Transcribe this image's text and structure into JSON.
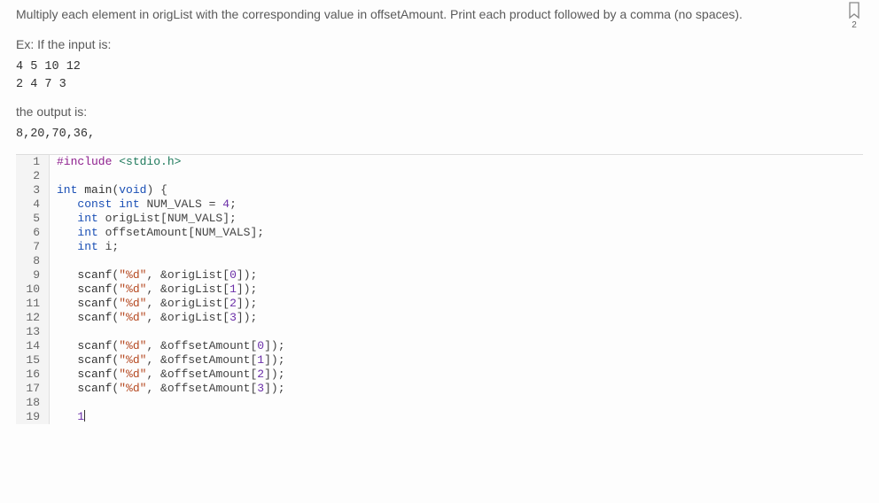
{
  "problem": {
    "description": "Multiply each element in origList with the corresponding value in offsetAmount. Print each product followed by a comma (no spaces).",
    "example_label": "Ex: If the input is:",
    "example_input": "4 5 10 12\n2 4 7 3",
    "output_label": "the output is:",
    "example_output": "8,20,70,36,"
  },
  "bookmark": {
    "count": "2"
  },
  "code": {
    "lines": [
      {
        "n": "1",
        "tokens": [
          [
            "pp",
            "#include "
          ],
          [
            "inc",
            "<stdio.h>"
          ]
        ]
      },
      {
        "n": "2",
        "tokens": []
      },
      {
        "n": "3",
        "tokens": [
          [
            "type",
            "int"
          ],
          [
            "plain",
            " "
          ],
          [
            "fn",
            "main"
          ],
          [
            "plain",
            "("
          ],
          [
            "type",
            "void"
          ],
          [
            "plain",
            ") {"
          ]
        ]
      },
      {
        "n": "4",
        "tokens": [
          [
            "plain",
            "   "
          ],
          [
            "kw",
            "const"
          ],
          [
            "plain",
            " "
          ],
          [
            "type",
            "int"
          ],
          [
            "plain",
            " NUM_VALS = "
          ],
          [
            "num",
            "4"
          ],
          [
            "plain",
            ";"
          ]
        ]
      },
      {
        "n": "5",
        "tokens": [
          [
            "plain",
            "   "
          ],
          [
            "type",
            "int"
          ],
          [
            "plain",
            " origList[NUM_VALS];"
          ]
        ]
      },
      {
        "n": "6",
        "tokens": [
          [
            "plain",
            "   "
          ],
          [
            "type",
            "int"
          ],
          [
            "plain",
            " offsetAmount[NUM_VALS];"
          ]
        ]
      },
      {
        "n": "7",
        "tokens": [
          [
            "plain",
            "   "
          ],
          [
            "type",
            "int"
          ],
          [
            "plain",
            " i;"
          ]
        ]
      },
      {
        "n": "8",
        "tokens": []
      },
      {
        "n": "9",
        "tokens": [
          [
            "plain",
            "   "
          ],
          [
            "fn",
            "scanf"
          ],
          [
            "plain",
            "("
          ],
          [
            "str",
            "\"%d\""
          ],
          [
            "plain",
            ", &origList["
          ],
          [
            "num",
            "0"
          ],
          [
            "plain",
            "]);"
          ]
        ]
      },
      {
        "n": "10",
        "tokens": [
          [
            "plain",
            "   "
          ],
          [
            "fn",
            "scanf"
          ],
          [
            "plain",
            "("
          ],
          [
            "str",
            "\"%d\""
          ],
          [
            "plain",
            ", &origList["
          ],
          [
            "num",
            "1"
          ],
          [
            "plain",
            "]);"
          ]
        ]
      },
      {
        "n": "11",
        "tokens": [
          [
            "plain",
            "   "
          ],
          [
            "fn",
            "scanf"
          ],
          [
            "plain",
            "("
          ],
          [
            "str",
            "\"%d\""
          ],
          [
            "plain",
            ", &origList["
          ],
          [
            "num",
            "2"
          ],
          [
            "plain",
            "]);"
          ]
        ]
      },
      {
        "n": "12",
        "tokens": [
          [
            "plain",
            "   "
          ],
          [
            "fn",
            "scanf"
          ],
          [
            "plain",
            "("
          ],
          [
            "str",
            "\"%d\""
          ],
          [
            "plain",
            ", &origList["
          ],
          [
            "num",
            "3"
          ],
          [
            "plain",
            "]);"
          ]
        ]
      },
      {
        "n": "13",
        "tokens": []
      },
      {
        "n": "14",
        "tokens": [
          [
            "plain",
            "   "
          ],
          [
            "fn",
            "scanf"
          ],
          [
            "plain",
            "("
          ],
          [
            "str",
            "\"%d\""
          ],
          [
            "plain",
            ", &offsetAmount["
          ],
          [
            "num",
            "0"
          ],
          [
            "plain",
            "]);"
          ]
        ]
      },
      {
        "n": "15",
        "tokens": [
          [
            "plain",
            "   "
          ],
          [
            "fn",
            "scanf"
          ],
          [
            "plain",
            "("
          ],
          [
            "str",
            "\"%d\""
          ],
          [
            "plain",
            ", &offsetAmount["
          ],
          [
            "num",
            "1"
          ],
          [
            "plain",
            "]);"
          ]
        ]
      },
      {
        "n": "16",
        "tokens": [
          [
            "plain",
            "   "
          ],
          [
            "fn",
            "scanf"
          ],
          [
            "plain",
            "("
          ],
          [
            "str",
            "\"%d\""
          ],
          [
            "plain",
            ", &offsetAmount["
          ],
          [
            "num",
            "2"
          ],
          [
            "plain",
            "]);"
          ]
        ]
      },
      {
        "n": "17",
        "tokens": [
          [
            "plain",
            "   "
          ],
          [
            "fn",
            "scanf"
          ],
          [
            "plain",
            "("
          ],
          [
            "str",
            "\"%d\""
          ],
          [
            "plain",
            ", &offsetAmount["
          ],
          [
            "num",
            "3"
          ],
          [
            "plain",
            "]);"
          ]
        ]
      },
      {
        "n": "18",
        "tokens": []
      },
      {
        "n": "19",
        "tokens": [
          [
            "plain",
            "   "
          ],
          [
            "num",
            "1"
          ]
        ],
        "cursor_after": true
      }
    ]
  }
}
